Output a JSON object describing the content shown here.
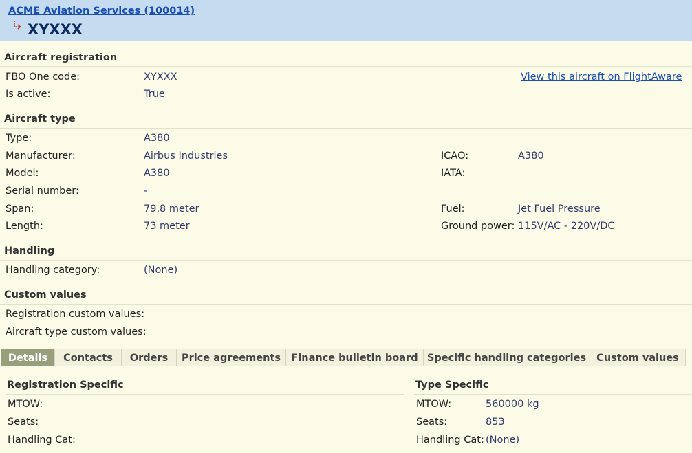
{
  "header": {
    "company_link": "ACME Aviation Services (100014)",
    "registration": "XYXXX"
  },
  "aircraft_registration": {
    "title": "Aircraft registration",
    "fbo_label": "FBO One code:",
    "fbo_value": "XYXXX",
    "active_label": "Is active:",
    "active_value": "True",
    "flightaware_link": "View this aircraft on FlightAware"
  },
  "aircraft_type": {
    "title": "Aircraft type",
    "type_label": "Type:",
    "type_value": "A380",
    "manufacturer_label": "Manufacturer:",
    "manufacturer_value": "Airbus Industries",
    "model_label": "Model:",
    "model_value": "A380",
    "serial_label": "Serial number:",
    "serial_value": "-",
    "span_label": "Span:",
    "span_value": "79.8 meter",
    "length_label": "Length:",
    "length_value": "73 meter",
    "icao_label": "ICAO:",
    "icao_value": "A380",
    "iata_label": "IATA:",
    "iata_value": "",
    "fuel_label": "Fuel:",
    "fuel_value": "Jet Fuel Pressure",
    "ground_power_label": "Ground power:",
    "ground_power_value": "115V/AC - 220V/DC"
  },
  "handling": {
    "title": "Handling",
    "category_label": "Handling category:",
    "category_value": "(None)"
  },
  "custom_values": {
    "title": "Custom values",
    "registration_label": "Registration custom values:",
    "aircraft_type_label": "Aircraft type custom values:"
  },
  "tabs": [
    {
      "label": "Details",
      "active": true
    },
    {
      "label": "Contacts",
      "active": false
    },
    {
      "label": "Orders",
      "active": false
    },
    {
      "label": "Price agreements",
      "active": false
    },
    {
      "label": "Finance bulletin board",
      "active": false
    },
    {
      "label": "Specific handling categories",
      "active": false
    },
    {
      "label": "Custom values",
      "active": false
    }
  ],
  "registration_specific": {
    "title": "Registration Specific",
    "mtow_label": "MTOW:",
    "mtow_value": "",
    "seats_label": "Seats:",
    "seats_value": "",
    "handling_label": "Handling Cat:",
    "handling_value": ""
  },
  "type_specific": {
    "title": "Type Specific",
    "mtow_label": "MTOW:",
    "mtow_value": "560000 kg",
    "seats_label": "Seats:",
    "seats_value": "853",
    "handling_label": "Handling Cat:",
    "handling_value": "(None)"
  },
  "colors": {
    "header_bg": "#c5dcf0",
    "page_bg": "#fbfbe8",
    "active_tab": "#989f7c",
    "link": "#1a4fb0"
  }
}
